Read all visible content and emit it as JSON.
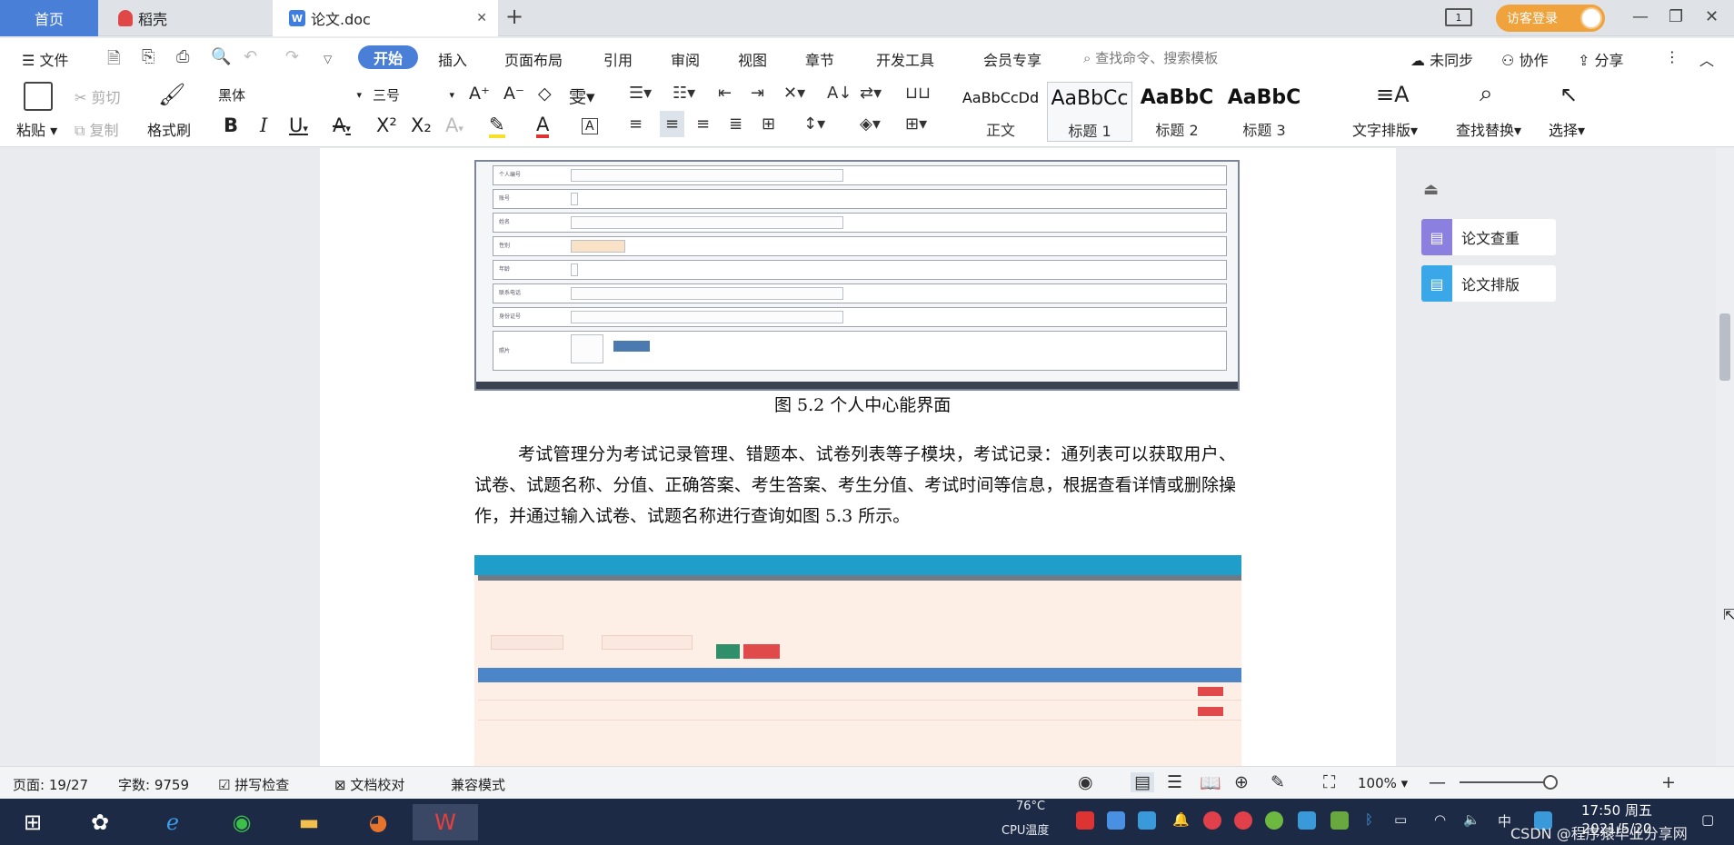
{
  "tabs": {
    "home": "首页",
    "daoke": "稻壳",
    "doc": "论文.doc"
  },
  "account": {
    "visit_login": "访客登录"
  },
  "menu": {
    "file": "文件",
    "items": [
      "开始",
      "插入",
      "页面布局",
      "引用",
      "审阅",
      "视图",
      "章节",
      "开发工具",
      "会员专享"
    ],
    "search_placeholder": "查找命令、搜索模板",
    "sync": "未同步",
    "collab": "协作",
    "share": "分享"
  },
  "ribbon": {
    "paste": "粘贴",
    "cut": "剪切",
    "copy": "复制",
    "format_painter": "格式刷",
    "font_name": "黑体",
    "font_size": "三号",
    "styles": [
      {
        "sample": "AaBbCcDd",
        "name": "正文"
      },
      {
        "sample": "AaBbCc",
        "name": "标题 1"
      },
      {
        "sample": "AaBbC",
        "name": "标题 2"
      },
      {
        "sample": "AaBbC",
        "name": "标题 3"
      }
    ],
    "text_layout": "文字排版",
    "find_replace": "查找替换",
    "select": "选择"
  },
  "document": {
    "caption": "图 5.2 个人中心能界面",
    "paragraph": "考试管理分为考试记录管理、错题本、试卷列表等子模块，考试记录：通列表可以获取用户、试卷、试题名称、分值、正确答案、考生答案、考生分值、考试时间等信息，根据查看详情或删除操作，并通过输入试卷、试题名称进行查询如图 5.3 所示。"
  },
  "side_panel": {
    "check": "论文查重",
    "layout": "论文排版"
  },
  "status": {
    "page": "页面: 19/27",
    "words": "字数: 9759",
    "spell": "拼写检查",
    "proof": "文档校对",
    "compat": "兼容模式",
    "zoom": "100%"
  },
  "taskbar": {
    "cpu_temp": "76°C",
    "cpu_label": "CPU温度",
    "ime": "中",
    "time": "17:50 周五",
    "date": "2021/5/20",
    "watermark": "CSDN @程序猿毕业分享网"
  },
  "colors": {
    "accent": "#4a7fd8",
    "login": "#f0a23c",
    "taskbar": "#1c2a45",
    "check_icon": "#8b7fe0",
    "layout_icon": "#3aa7e8"
  }
}
